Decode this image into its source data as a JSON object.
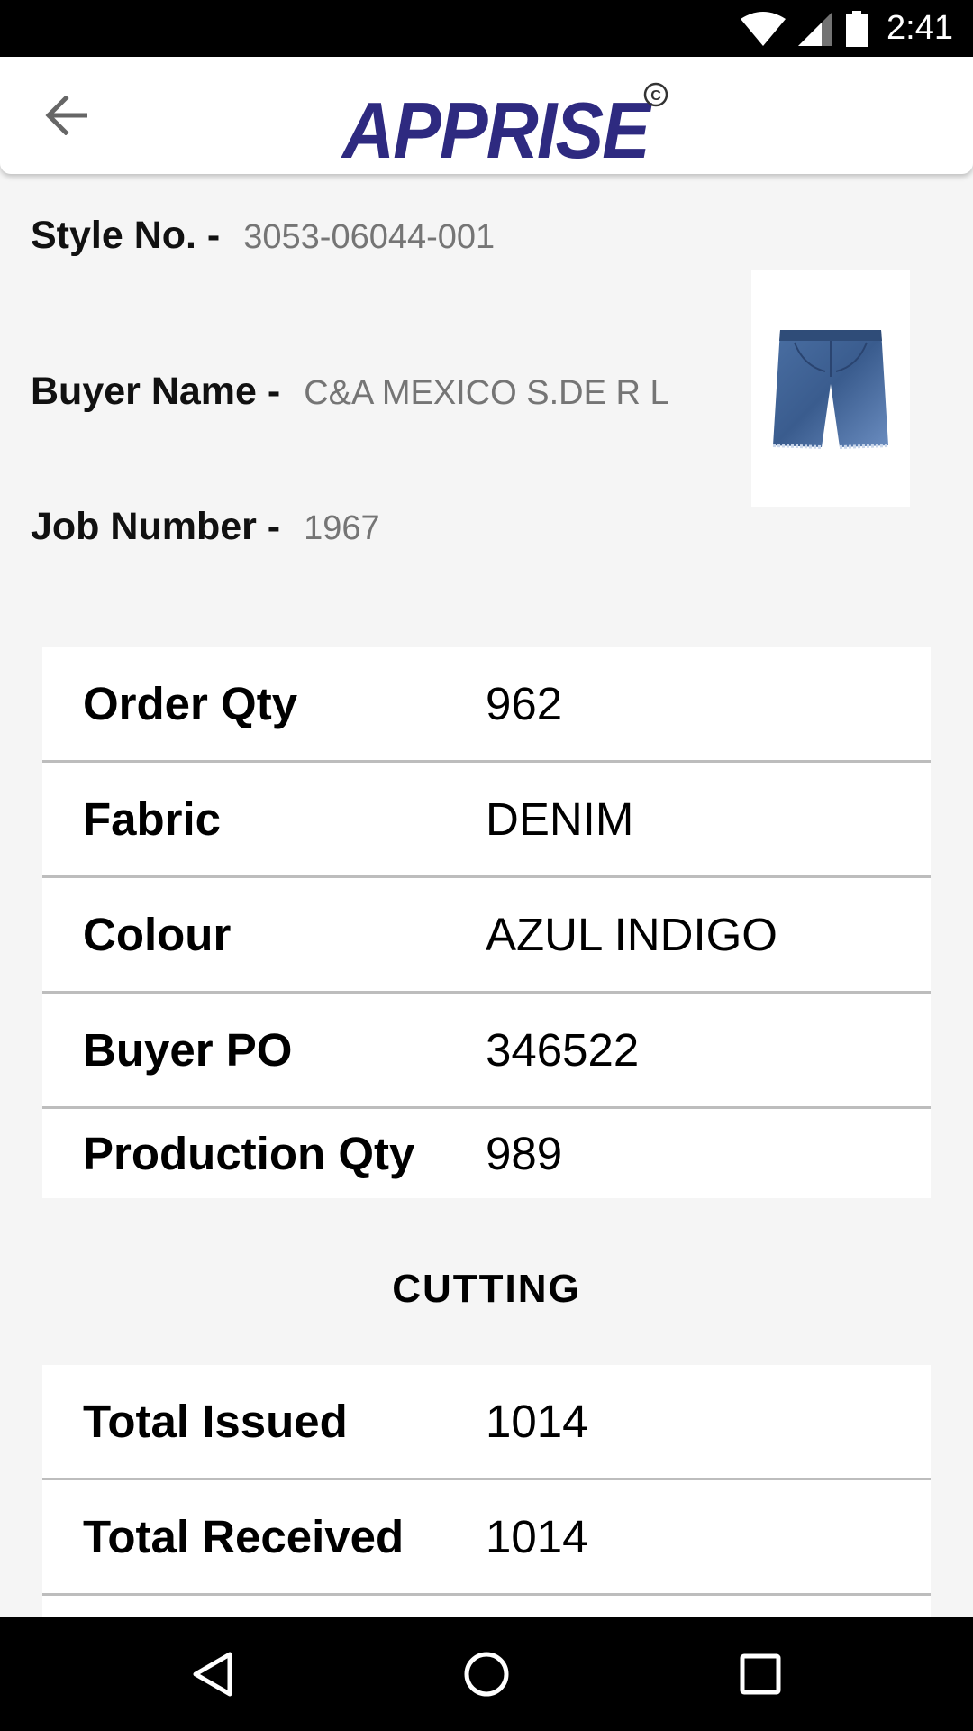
{
  "status_bar": {
    "time": "2:41",
    "icons": [
      "wifi-icon",
      "signal-icon",
      "battery-icon"
    ]
  },
  "app_bar": {
    "back_icon": "arrow-back-icon",
    "logo_text": "APPRISE",
    "logo_mark": "©",
    "logo_color": "#2e2a80"
  },
  "header": {
    "style_label": "Style No. -",
    "style_value": "3053-06044-001",
    "buyer_label": "Buyer Name -",
    "buyer_value": "C&A MEXICO S.DE R L",
    "job_label": "Job Number -",
    "job_value": "1967"
  },
  "product_image": "denim-shorts-image",
  "order_table": [
    {
      "label": "Order Qty",
      "value": "962"
    },
    {
      "label": "Fabric",
      "value": "DENIM"
    },
    {
      "label": "Colour",
      "value": "AZUL INDIGO"
    },
    {
      "label": "Buyer PO",
      "value": "346522"
    },
    {
      "label": "Production Qty",
      "value": "989"
    }
  ],
  "cutting": {
    "title": "CUTTING",
    "rows": [
      {
        "label": "Total Issued",
        "value": "1014"
      },
      {
        "label": "Total Received",
        "value": "1014"
      }
    ]
  },
  "nav_bar": {
    "icons": [
      "back-triangle-icon",
      "home-circle-icon",
      "recents-square-icon"
    ]
  }
}
